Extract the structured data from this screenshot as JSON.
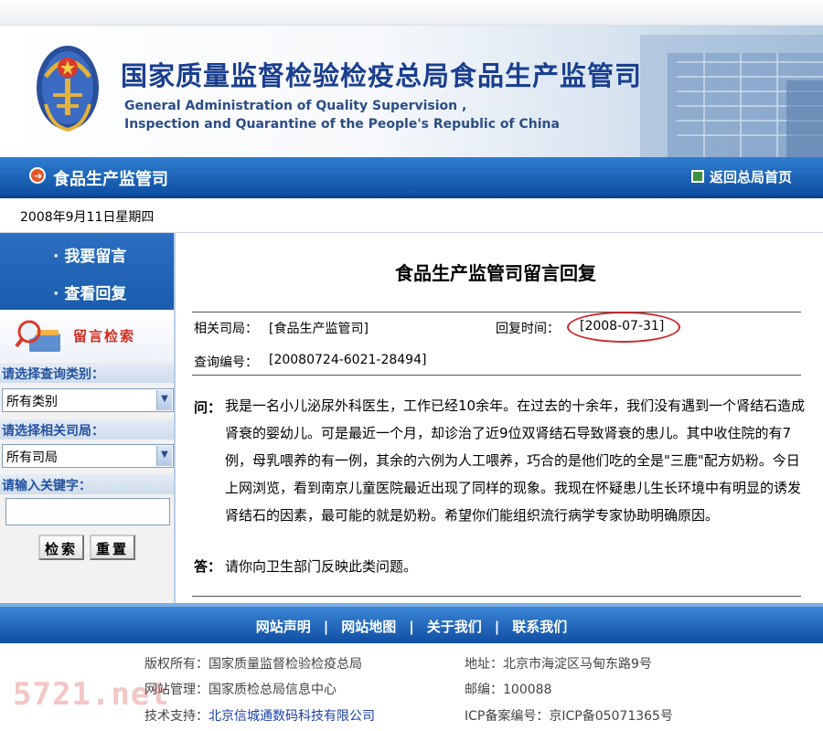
{
  "header": {
    "title": "国家质量监督检验检疫总局食品生产监管司",
    "subtitle_line1": "General Administration of Quality Supervision ,",
    "subtitle_line2": "Inspection and Quarantine of the People's Republic of China"
  },
  "nav": {
    "section": "食品生产监管司",
    "home_link": "返回总局首页"
  },
  "date": "2008年9月11日星期四",
  "sidebar": {
    "menu": [
      "· 我要留言",
      "· 查看回复"
    ],
    "search_title": "留言检索",
    "category_label": "请选择查询类别：",
    "category_value": "所有类别",
    "dept_label": "请选择相关司局：",
    "dept_value": "所有司局",
    "keyword_label": "请输入关键字：",
    "keyword_value": "",
    "search_button": "检索",
    "reset_button": "重置"
  },
  "message": {
    "title": "食品生产监管司留言回复",
    "dept_label": "相关司局：",
    "dept_value": "[食品生产监管司]",
    "time_label": "回复时间：",
    "time_value": "[2008-07-31]",
    "number_label": "查询编号：",
    "number_value": "[20080724-6021-28494]",
    "question_label": "问：",
    "question_text": "我是一名小儿泌尿外科医生，工作已经10余年。在过去的十余年，我们没有遇到一个肾结石造成肾衰的婴幼儿。可是最近一个月，却诊治了近9位双肾结石导致肾衰的患儿。其中收住院的有7例，母乳喂养的有一例，其余的六例为人工喂养，巧合的是他们吃的全是\"三鹿\"配方奶粉。今日上网浏览，看到南京儿童医院最近出现了同样的现象。我现在怀疑患儿生长环境中有明显的诱发肾结石的因素，最可能的就是奶粉。希望你们能组织流行病学专家协助明确原因。",
    "answer_label": "答：",
    "answer_text": "请你向卫生部门反映此类问题。"
  },
  "footer": {
    "links": [
      "网站声明",
      "网站地图",
      "关于我们",
      "联系我们"
    ],
    "separator": "|",
    "copyright": "版权所有：国家质量监督检验检疫总局",
    "admin": "网站管理：国家质检总局信息中心",
    "support_label": "技术支持：",
    "support_value": "北京信城通数码科技有限公司",
    "address": "地址：北京市海淀区马甸东路9号",
    "postcode": "邮编：100088",
    "icp": "ICP备案编号：京ICP备05071365号",
    "watermark": "5721.net"
  },
  "colors": {
    "nav_blue": "#1a5cae",
    "title_blue": "#1b3f8f",
    "highlight_red": "#d0262a"
  }
}
